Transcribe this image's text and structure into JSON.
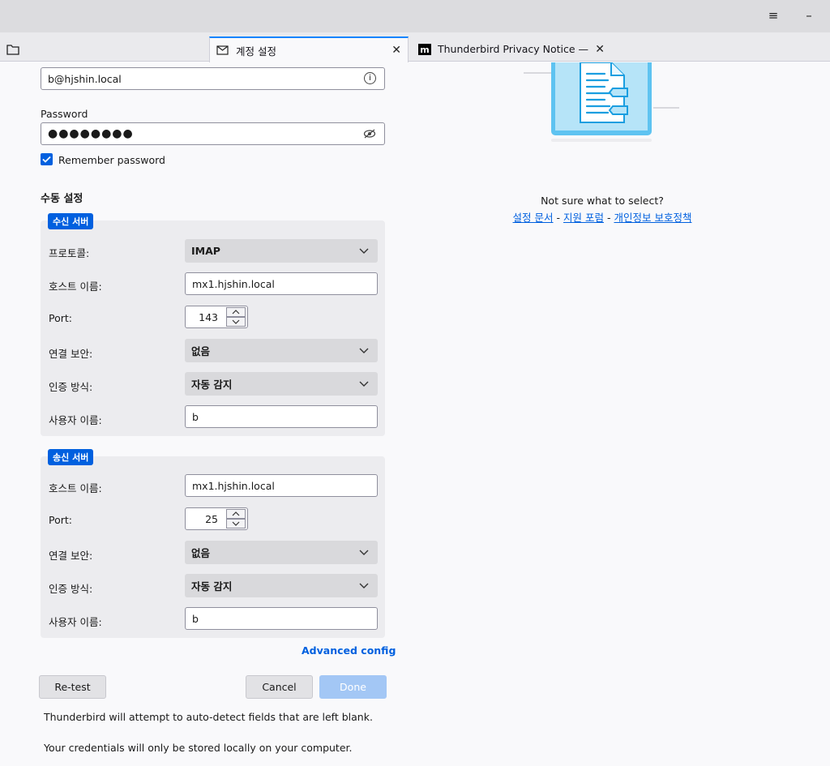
{
  "window": {
    "menu_icon": "hamburger-menu-icon",
    "minimize_icon": "minimize-icon"
  },
  "tabs": [
    {
      "label": "",
      "icon": "folder-icon",
      "active": false
    },
    {
      "label": "계정 설정",
      "icon": "mail-edit-icon",
      "active": true
    },
    {
      "label": "Thunderbird Privacy Notice — Mo",
      "icon": "m-logo-icon",
      "active": false
    }
  ],
  "account": {
    "email_value": "b@hjshin.local",
    "password_label": "Password",
    "password_mask": "●●●●●●●●",
    "remember_label": "Remember password",
    "remember_checked": true
  },
  "manual": {
    "title": "수동 설정",
    "incoming": {
      "legend": "수신 서버",
      "protocol_label": "프로토콜:",
      "protocol_value": "IMAP",
      "hostname_label": "호스트 이름:",
      "hostname_value": "mx1.hjshin.local",
      "port_label": "Port:",
      "port_value": "143",
      "security_label": "연결 보안:",
      "security_value": "없음",
      "auth_label": "인증 방식:",
      "auth_value": "자동 감지",
      "username_label": "사용자 이름:",
      "username_value": "b"
    },
    "outgoing": {
      "legend": "송신 서버",
      "hostname_label": "호스트 이름:",
      "hostname_value": "mx1.hjshin.local",
      "port_label": "Port:",
      "port_value": "25",
      "security_label": "연결 보안:",
      "security_value": "없음",
      "auth_label": "인증 방식:",
      "auth_value": "자동 감지",
      "username_label": "사용자 이름:",
      "username_value": "b"
    },
    "advanced_config": "Advanced config"
  },
  "buttons": {
    "retest": "Re-test",
    "cancel": "Cancel",
    "done": "Done"
  },
  "notes": {
    "autodetect": "Thunderbird will attempt to auto-detect fields that are left blank.",
    "credentials": "Your credentials will only be stored locally on your computer."
  },
  "help": {
    "question": "Not sure what to select?",
    "link_docs": "설정 문서",
    "sep1": "-",
    "link_forum": "지원 포럼",
    "sep2": "-",
    "link_privacy": "개인정보 보호정책"
  },
  "colors": {
    "accent": "#0060df",
    "done_disabled": "#a3c7f5",
    "illustration": "#5ec3f1"
  }
}
